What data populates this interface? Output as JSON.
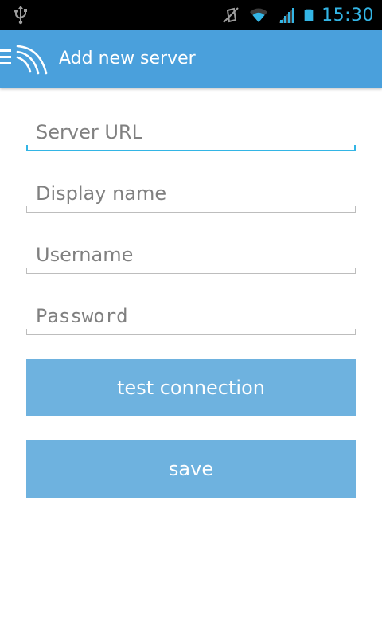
{
  "status_bar": {
    "time": "15:30",
    "icons": [
      "usb-icon",
      "vibrate-mute-icon",
      "wifi-icon",
      "signal-icon",
      "battery-icon"
    ],
    "accent_color": "#33b5e5"
  },
  "action_bar": {
    "title": "Add new server",
    "background_color": "#4aa0dc",
    "icons": [
      "menu-icon",
      "app-logo-icon"
    ]
  },
  "form": {
    "server_url": {
      "placeholder": "Server URL",
      "value": ""
    },
    "display_name": {
      "placeholder": "Display name",
      "value": ""
    },
    "username": {
      "placeholder": "Username",
      "value": ""
    },
    "password": {
      "placeholder": "Password",
      "value": ""
    },
    "focus_color": "#33b5e5"
  },
  "buttons": {
    "test_connection": "test connection",
    "save": "save",
    "background_color": "#6eb2df"
  }
}
